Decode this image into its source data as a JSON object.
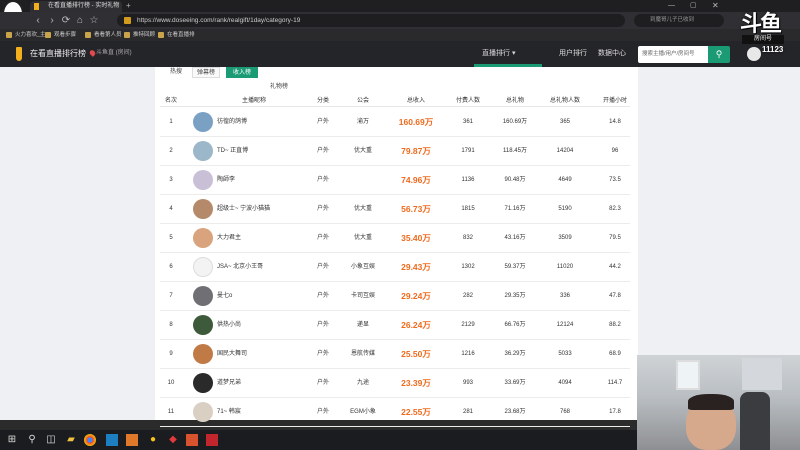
{
  "browser": {
    "tabs": [
      {
        "label": "在看直播排行榜 - 实时礼物总..."
      }
    ],
    "new_tab_label": "+",
    "nav": {
      "back": "‹",
      "forward": "›",
      "reload": "⟳",
      "home": "⌂",
      "star": "☆"
    },
    "url": "https://www.doseeing.com/rank/realgift/1day/category-19",
    "search_placeholder": "到魔哥儿子已收到",
    "bookmarks": [
      "火力喜欢_主",
      "观看步骤",
      "看看第人员",
      "推特回顾",
      "在看直播排"
    ]
  },
  "site": {
    "name": "在看直播排行榜",
    "location": "斗鱼直 (房间)",
    "nav": [
      "直播排行 ▾",
      "用户排行",
      "数据中心"
    ],
    "search_placeholder": "搜索主播/用户/房间号",
    "search_icon": "search-icon"
  },
  "filters": {
    "row1": [
      "热搜",
      "弹幕榜",
      "收入榜",
      "礼物榜"
    ],
    "row2": [],
    "active": "收入榜"
  },
  "table": {
    "headers": [
      "名次",
      "主播昵称",
      "分类",
      "公会",
      "总收入",
      "付费人数",
      "总礼物",
      "总礼物人数",
      "开播小时"
    ],
    "rows": [
      {
        "rank": "1",
        "name": "彷徨的鸽博",
        "cat": "户外",
        "guild": "渝万",
        "income": "160.69万",
        "payers": "361",
        "gifts": "160.69万",
        "gift_users": "365",
        "hours": "14.8"
      },
      {
        "rank": "2",
        "name": "TD~ 正直博",
        "cat": "户外",
        "guild": "优大重",
        "income": "79.87万",
        "payers": "1791",
        "gifts": "118.45万",
        "gift_users": "14204",
        "hours": "96"
      },
      {
        "rank": "3",
        "name": "陶師李",
        "cat": "户外",
        "guild": "",
        "income": "74.96万",
        "payers": "1136",
        "gifts": "90.48万",
        "gift_users": "4649",
        "hours": "73.5"
      },
      {
        "rank": "4",
        "name": "超级士~ 宁波小猫猫",
        "cat": "户外",
        "guild": "优大重",
        "income": "56.73万",
        "payers": "1815",
        "gifts": "71.16万",
        "gift_users": "5190",
        "hours": "82.3"
      },
      {
        "rank": "5",
        "name": "大力君主",
        "cat": "户外",
        "guild": "优大重",
        "income": "35.40万",
        "payers": "832",
        "gifts": "43.16万",
        "gift_users": "3509",
        "hours": "79.5"
      },
      {
        "rank": "6",
        "name": "JSA~ 北京小王哥",
        "cat": "户外",
        "guild": "小象互娱",
        "income": "29.43万",
        "payers": "1302",
        "gifts": "59.37万",
        "gift_users": "11020",
        "hours": "44.2"
      },
      {
        "rank": "7",
        "name": "曼七o",
        "cat": "户外",
        "guild": "卡司互娱",
        "income": "29.24万",
        "payers": "282",
        "gifts": "29.35万",
        "gift_users": "336",
        "hours": "47.8"
      },
      {
        "rank": "8",
        "name": "供热小尚",
        "cat": "户外",
        "guild": "递显",
        "income": "26.24万",
        "payers": "2129",
        "gifts": "66.76万",
        "gift_users": "12124",
        "hours": "88.2"
      },
      {
        "rank": "9",
        "name": "国民大舞司",
        "cat": "户外",
        "guild": "恩航传媒",
        "income": "25.50万",
        "payers": "1216",
        "gifts": "36.29万",
        "gift_users": "5033",
        "hours": "68.9"
      },
      {
        "rank": "10",
        "name": "道梦兄弟",
        "cat": "户外",
        "guild": "九途",
        "income": "23.39万",
        "payers": "993",
        "gifts": "33.69万",
        "gift_users": "4094",
        "hours": "114.7"
      },
      {
        "rank": "11",
        "name": "71~ 韩宸",
        "cat": "户外",
        "guild": "EGM小象",
        "income": "22.55万",
        "payers": "281",
        "gifts": "23.68万",
        "gift_users": "768",
        "hours": "17.8"
      }
    ]
  },
  "overlay": {
    "brand": "斗鱼",
    "sub": "房间号",
    "room_id": "11123"
  },
  "taskbar": {
    "start": "⊞",
    "search": "⚲",
    "taskview": "◫"
  },
  "colors": {
    "accent": "#1a9b74",
    "income": "#f06a1d",
    "header_bg": "#242529"
  }
}
